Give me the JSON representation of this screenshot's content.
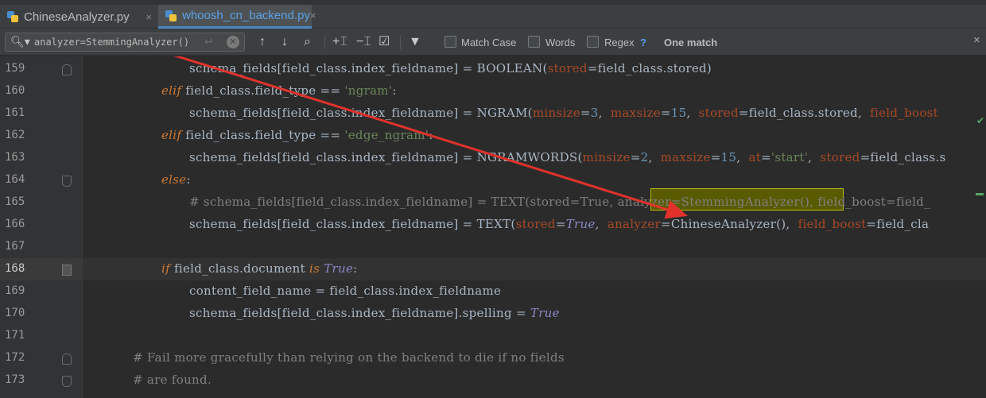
{
  "tabs": [
    {
      "label": "ChineseAnalyzer.py",
      "close": "×",
      "active": false
    },
    {
      "label": "whoosh_cn_backend.py",
      "close": "×",
      "active": true
    }
  ],
  "find": {
    "query": "analyzer=StemmingAnalyzer()",
    "options": [
      {
        "label": "Match Case",
        "checked": false
      },
      {
        "label": "Words",
        "checked": false
      },
      {
        "label": "Regex",
        "checked": false
      }
    ],
    "help": "?",
    "match_status": "One match",
    "close": "×"
  },
  "icons": {
    "search": "search-icon",
    "newline": "newline-icon",
    "clear": "clear-icon",
    "prev": "arrow-up-icon",
    "next": "arrow-down-icon",
    "find_all": "find-all-icon",
    "add_occurrence": "add-occurrence-icon",
    "remove_occurrence": "remove-occurrence-icon",
    "select_all": "select-all-occurrences-icon",
    "filter": "filter-icon"
  },
  "colors": {
    "editor_bg": "#2b2b2b",
    "keyword": "#cc7832",
    "string": "#6a8759",
    "number": "#6897bb",
    "param": "#aa4926",
    "comment": "#808080",
    "match_highlight": "#5a5a00",
    "arrow": "#e0322b"
  },
  "editor": {
    "lines": [
      {
        "n": "159",
        "indent": 238,
        "current": false,
        "fold": "up",
        "code": [
          {
            "t": "schema_fields[field_class.index_fieldname] = BOOLEAN(",
            "c": ""
          },
          {
            "t": "stored",
            "c": "param"
          },
          {
            "t": "=field_class.stored)",
            "c": ""
          }
        ]
      },
      {
        "n": "160",
        "indent": 203,
        "current": false,
        "fold": "",
        "code": [
          {
            "t": "elif",
            "c": "kw"
          },
          {
            "t": " field_class.field_type == ",
            "c": ""
          },
          {
            "t": "'ngram'",
            "c": "str"
          },
          {
            "t": ":",
            "c": ""
          }
        ]
      },
      {
        "n": "161",
        "indent": 238,
        "current": false,
        "fold": "",
        "code": [
          {
            "t": "schema_fields[field_class.index_fieldname] = NGRAM(",
            "c": ""
          },
          {
            "t": "minsize",
            "c": "param"
          },
          {
            "t": "=",
            "c": ""
          },
          {
            "t": "3",
            "c": "num"
          },
          {
            "t": ",  ",
            "c": ""
          },
          {
            "t": "maxsize",
            "c": "param"
          },
          {
            "t": "=",
            "c": ""
          },
          {
            "t": "15",
            "c": "num"
          },
          {
            "t": ",  ",
            "c": ""
          },
          {
            "t": "stored",
            "c": "param"
          },
          {
            "t": "=field_class.stored,  ",
            "c": ""
          },
          {
            "t": "field_boost",
            "c": "param"
          }
        ]
      },
      {
        "n": "162",
        "indent": 203,
        "current": false,
        "fold": "",
        "code": [
          {
            "t": "elif",
            "c": "kw"
          },
          {
            "t": " field_class.field_type == ",
            "c": ""
          },
          {
            "t": "'edge_ngram'",
            "c": "str"
          },
          {
            "t": ":",
            "c": ""
          }
        ]
      },
      {
        "n": "163",
        "indent": 238,
        "current": false,
        "fold": "",
        "code": [
          {
            "t": "schema_fields[field_class.index_fieldname] = NGRAMWORDS(",
            "c": ""
          },
          {
            "t": "minsize",
            "c": "param"
          },
          {
            "t": "=",
            "c": ""
          },
          {
            "t": "2",
            "c": "num"
          },
          {
            "t": ",  ",
            "c": ""
          },
          {
            "t": "maxsize",
            "c": "param"
          },
          {
            "t": "=",
            "c": ""
          },
          {
            "t": "15",
            "c": "num"
          },
          {
            "t": ",  ",
            "c": ""
          },
          {
            "t": "at",
            "c": "param"
          },
          {
            "t": "=",
            "c": ""
          },
          {
            "t": "'start'",
            "c": "str"
          },
          {
            "t": ",  ",
            "c": ""
          },
          {
            "t": "stored",
            "c": "param"
          },
          {
            "t": "=field_class.s",
            "c": ""
          }
        ]
      },
      {
        "n": "164",
        "indent": 203,
        "current": false,
        "fold": "down",
        "code": [
          {
            "t": "else",
            "c": "kw"
          },
          {
            "t": ":",
            "c": ""
          }
        ]
      },
      {
        "n": "165",
        "indent": 238,
        "current": false,
        "fold": "",
        "code": [
          {
            "t": "# schema_fields[field_class.index_fieldname] = TEXT(stored=True, analyzer=StemmingAnalyzer(), field_boost=field_",
            "c": "com"
          }
        ]
      },
      {
        "n": "166",
        "indent": 238,
        "current": false,
        "fold": "",
        "code": [
          {
            "t": "schema_fields[field_class.index_fieldname] = TEXT(",
            "c": ""
          },
          {
            "t": "stored",
            "c": "param"
          },
          {
            "t": "=",
            "c": ""
          },
          {
            "t": "True",
            "c": "kt"
          },
          {
            "t": ",  ",
            "c": ""
          },
          {
            "t": "analyzer",
            "c": "param"
          },
          {
            "t": "=ChineseAnalyzer(),  ",
            "c": ""
          },
          {
            "t": "field_boost",
            "c": "param"
          },
          {
            "t": "=field_cla",
            "c": ""
          }
        ]
      },
      {
        "n": "167",
        "indent": 238,
        "current": false,
        "fold": "",
        "code": []
      },
      {
        "n": "168",
        "indent": 203,
        "current": true,
        "fold": "pin",
        "code": [
          {
            "t": "if",
            "c": "kw"
          },
          {
            "t": " field_class.document ",
            "c": ""
          },
          {
            "t": "is",
            "c": "kw"
          },
          {
            "t": " ",
            "c": ""
          },
          {
            "t": "True",
            "c": "kt"
          },
          {
            "t": ":",
            "c": ""
          }
        ]
      },
      {
        "n": "169",
        "indent": 238,
        "current": false,
        "fold": "",
        "code": [
          {
            "t": "content_field_name = field_class.index_fieldname",
            "c": ""
          }
        ]
      },
      {
        "n": "170",
        "indent": 238,
        "current": false,
        "fold": "",
        "code": [
          {
            "t": "schema_fields[field_class.index_fieldname].spelling = ",
            "c": ""
          },
          {
            "t": "True",
            "c": "kt"
          }
        ]
      },
      {
        "n": "171",
        "indent": 238,
        "current": false,
        "fold": "",
        "code": []
      },
      {
        "n": "172",
        "indent": 167,
        "current": false,
        "fold": "up",
        "code": [
          {
            "t": "# Fail more gracefully than relying on the backend to die if no fields",
            "c": "com"
          }
        ]
      },
      {
        "n": "173",
        "indent": 167,
        "current": false,
        "fold": "down",
        "code": [
          {
            "t": "# are found.",
            "c": "com"
          }
        ]
      }
    ]
  }
}
